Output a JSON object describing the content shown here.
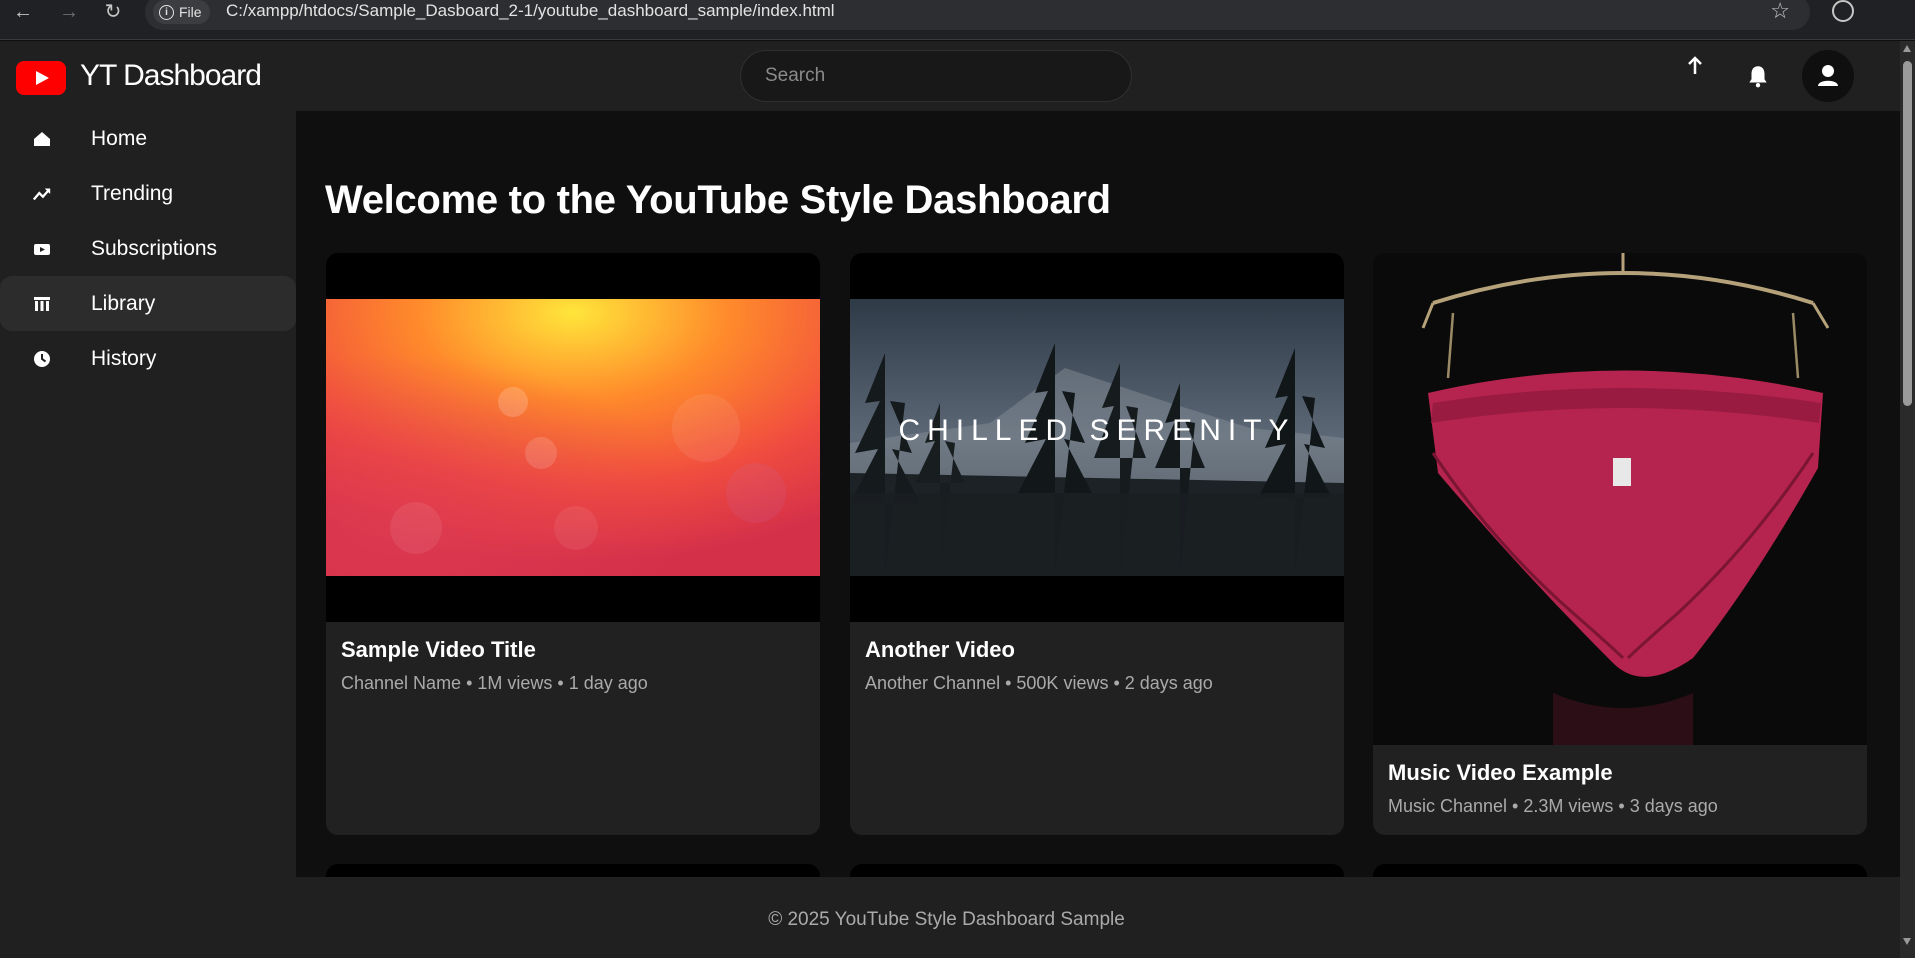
{
  "browser": {
    "file_chip": "File",
    "url": "C:/xampp/htdocs/Sample_Dasboard_2-1/youtube_dashboard_sample/index.html",
    "icons": [
      "back-icon",
      "forward-icon",
      "reload-icon",
      "info-icon",
      "star-icon",
      "profile-icon"
    ]
  },
  "header": {
    "logo_text": "YT Dashboard",
    "search_placeholder": "Search",
    "icons": [
      "upload-icon",
      "bell-icon",
      "user-icon"
    ]
  },
  "sidebar": {
    "items": [
      {
        "label": "Home",
        "icon": "home-icon",
        "active": false
      },
      {
        "label": "Trending",
        "icon": "trending-icon",
        "active": false
      },
      {
        "label": "Subscriptions",
        "icon": "subscriptions-icon",
        "active": false
      },
      {
        "label": "Library",
        "icon": "library-icon",
        "active": true
      },
      {
        "label": "History",
        "icon": "history-icon",
        "active": false
      }
    ]
  },
  "main": {
    "title": "Welcome to the YouTube Style Dashboard",
    "videos": [
      {
        "title": "Sample Video Title",
        "meta": "Channel Name • 1M views • 1 day ago",
        "thumbnail": "orange-bokeh-image"
      },
      {
        "title": "Another Video",
        "meta": "Another Channel • 500K views • 2 days ago",
        "thumbnail": "forest-mountain-image",
        "thumbnail_text": "CHILLED SERENITY"
      },
      {
        "title": "Music Video Example",
        "meta": "Music Channel • 2.3M views • 3 days ago",
        "thumbnail": "pink-garment-on-hanger-image"
      }
    ]
  },
  "footer": {
    "text": "© 2025 YouTube Style Dashboard Sample"
  },
  "colors": {
    "brand_red": "#ff0000",
    "background": "#0f0f0f",
    "surface": "#202020",
    "card": "#212121",
    "muted_text": "#aaaaaa"
  }
}
